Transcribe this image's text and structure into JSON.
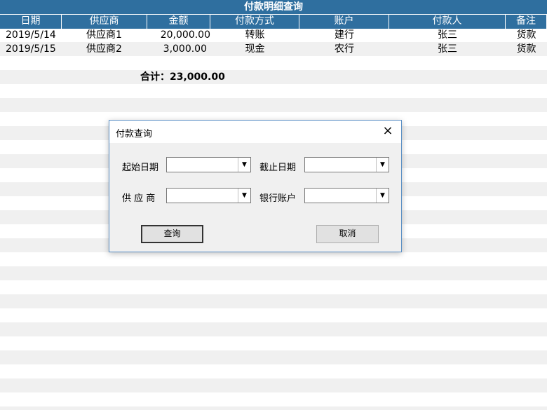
{
  "sheet": {
    "title": "付款明细查询",
    "columns": [
      "日期",
      "供应商",
      "金额",
      "付款方式",
      "账户",
      "付款人",
      "备注"
    ],
    "rows": [
      [
        "2019/5/14",
        "供应商1",
        "20,000.00",
        "转账",
        "建行",
        "张三",
        "货款"
      ],
      [
        "2019/5/15",
        "供应商2",
        "3,000.00",
        "现金",
        "农行",
        "张三",
        "货款"
      ]
    ],
    "total_text": "合计：23,000.00",
    "header_color": "#2f6f9f"
  },
  "dialog": {
    "title": "付款查询",
    "close_icon": "×",
    "fields": {
      "start_date_label": "起始日期",
      "start_date_value": "",
      "end_date_label": "截止日期",
      "end_date_value": "",
      "supplier_label": "供 应 商",
      "supplier_value": "",
      "bank_account_label": "银行账户",
      "bank_account_value": ""
    },
    "query_button": "查询",
    "cancel_button": "取消"
  }
}
